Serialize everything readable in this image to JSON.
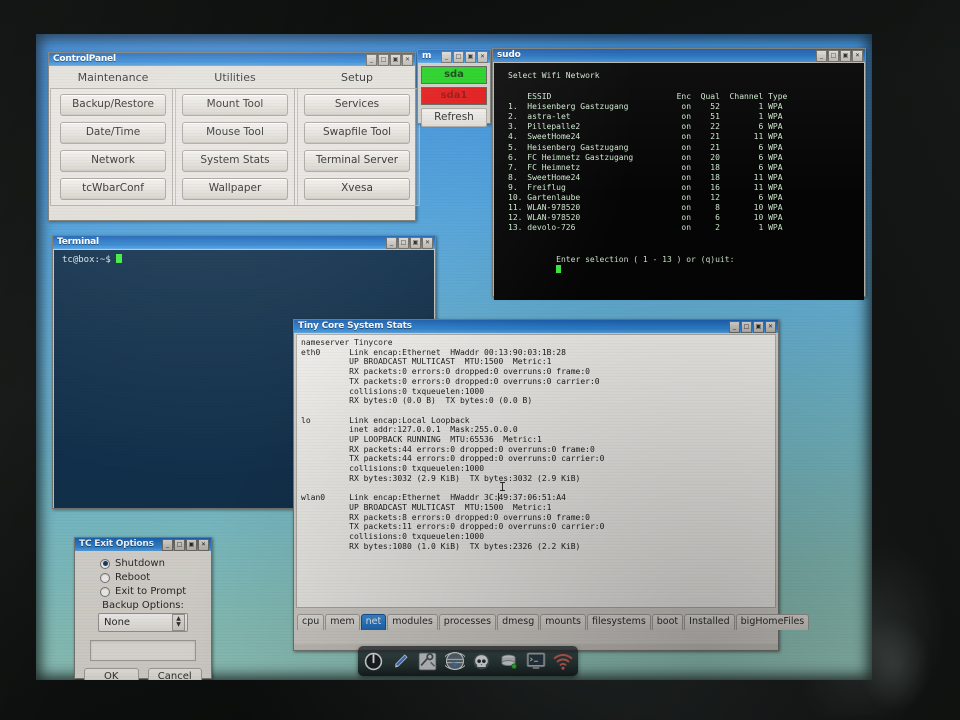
{
  "desktop": {
    "name": "Tiny Core Linux desktop photographed on a monitor"
  },
  "control_panel": {
    "title": "ControlPanel",
    "columns": [
      {
        "caption": "Maintenance",
        "buttons": [
          "Backup/Restore",
          "Date/Time",
          "Network",
          "tcWbarConf"
        ]
      },
      {
        "caption": "Utilities",
        "buttons": [
          "Mount Tool",
          "Mouse Tool",
          "System Stats",
          "Wallpaper"
        ]
      },
      {
        "caption": "Setup",
        "buttons": [
          "Services",
          "Swapfile Tool",
          "Terminal Server",
          "Xvesa"
        ]
      }
    ],
    "window_buttons": [
      "_",
      "□",
      "▣",
      "✕"
    ]
  },
  "mount_tool": {
    "title": "m",
    "devices": [
      {
        "label": "sda",
        "state": "mounted",
        "color": "#1fd01f"
      },
      {
        "label": "sda1",
        "state": "unmounted",
        "color": "#e21414"
      }
    ],
    "refresh_label": "Refresh",
    "window_buttons": [
      "_",
      "□",
      "▣",
      "✕"
    ]
  },
  "sudo_window": {
    "title": "sudo",
    "heading": "Select Wifi Network",
    "columns": [
      "ESSID",
      "Enc",
      "Qual",
      "Channel",
      "Type"
    ],
    "networks": [
      {
        "n": "1.",
        "essid": "Heisenberg Gastzugang",
        "enc": "on",
        "qual": "52",
        "channel": "1",
        "type": "WPA"
      },
      {
        "n": "2.",
        "essid": "astra-let",
        "enc": "on",
        "qual": "51",
        "channel": "1",
        "type": "WPA"
      },
      {
        "n": "3.",
        "essid": "Pillepalle2",
        "enc": "on",
        "qual": "22",
        "channel": "6",
        "type": "WPA"
      },
      {
        "n": "4.",
        "essid": "SweetHome24",
        "enc": "on",
        "qual": "21",
        "channel": "11",
        "type": "WPA"
      },
      {
        "n": "5.",
        "essid": "Heisenberg Gastzugang",
        "enc": "on",
        "qual": "21",
        "channel": "6",
        "type": "WPA"
      },
      {
        "n": "6.",
        "essid": "FC Heimnetz Gastzugang",
        "enc": "on",
        "qual": "20",
        "channel": "6",
        "type": "WPA"
      },
      {
        "n": "7.",
        "essid": "FC Heimnetz",
        "enc": "on",
        "qual": "18",
        "channel": "6",
        "type": "WPA"
      },
      {
        "n": "8.",
        "essid": "SweetHome24",
        "enc": "on",
        "qual": "18",
        "channel": "11",
        "type": "WPA"
      },
      {
        "n": "9.",
        "essid": "Freiflug",
        "enc": "on",
        "qual": "16",
        "channel": "11",
        "type": "WPA"
      },
      {
        "n": "10.",
        "essid": "Gartenlaube",
        "enc": "on",
        "qual": "12",
        "channel": "6",
        "type": "WPA"
      },
      {
        "n": "11.",
        "essid": "WLAN-978520",
        "enc": "on",
        "qual": "8",
        "channel": "10",
        "type": "WPA"
      },
      {
        "n": "12.",
        "essid": "WLAN-978520",
        "enc": "on",
        "qual": "6",
        "channel": "10",
        "type": "WPA"
      },
      {
        "n": "13.",
        "essid": "devolo-726",
        "enc": "on",
        "qual": "2",
        "channel": "1",
        "type": "WPA"
      }
    ],
    "prompt": "Enter selection ( 1 - 13 ) or (q)uit:",
    "window_buttons": [
      "_",
      "□",
      "▣",
      "✕"
    ]
  },
  "terminal": {
    "title": "Terminal",
    "prompt": "tc@box:~$",
    "window_buttons": [
      "_",
      "□",
      "▣",
      "✕"
    ]
  },
  "exit_options": {
    "title": "TC Exit Options",
    "radios": [
      {
        "label": "Shutdown",
        "selected": true
      },
      {
        "label": "Reboot",
        "selected": false
      },
      {
        "label": "Exit to Prompt",
        "selected": false
      }
    ],
    "backup_label": "Backup Options:",
    "backup_value": "None",
    "text_field_value": "",
    "ok_label": "OK",
    "cancel_label": "Cancel",
    "window_buttons": [
      "_",
      "□",
      "▣",
      "✕"
    ]
  },
  "system_stats": {
    "title": "Tiny Core System Stats",
    "output": "nameserver Tinycore\neth0      Link encap:Ethernet  HWaddr 00:13:90:03:1B:28\n          UP BROADCAST MULTICAST  MTU:1500  Metric:1\n          RX packets:0 errors:0 dropped:0 overruns:0 frame:0\n          TX packets:0 errors:0 dropped:0 overruns:0 carrier:0\n          collisions:0 txqueuelen:1000\n          RX bytes:0 (0.0 B)  TX bytes:0 (0.0 B)\n\nlo        Link encap:Local Loopback\n          inet addr:127.0.0.1  Mask:255.0.0.0\n          UP LOOPBACK RUNNING  MTU:65536  Metric:1\n          RX packets:44 errors:0 dropped:0 overruns:0 frame:0\n          TX packets:44 errors:0 dropped:0 overruns:0 carrier:0\n          collisions:0 txqueuelen:1000\n          RX bytes:3032 (2.9 KiB)  TX bytes:3032 (2.9 KiB)\n\nwlan0     Link encap:Ethernet  HWaddr 3C:49:37:06:51:A4\n          UP BROADCAST MULTICAST  MTU:1500  Metric:1\n          RX packets:8 errors:0 dropped:0 overruns:0 frame:0\n          TX packets:11 errors:0 dropped:0 overruns:0 carrier:0\n          collisions:0 txqueuelen:1000\n          RX bytes:1080 (1.0 KiB)  TX bytes:2326 (2.2 KiB)",
    "tabs": [
      {
        "label": "cpu",
        "selected": false
      },
      {
        "label": "mem",
        "selected": false
      },
      {
        "label": "net",
        "selected": true
      },
      {
        "label": "modules",
        "selected": false
      },
      {
        "label": "processes",
        "selected": false
      },
      {
        "label": "dmesg",
        "selected": false
      },
      {
        "label": "mounts",
        "selected": false
      },
      {
        "label": "filesystems",
        "selected": false
      },
      {
        "label": "boot",
        "selected": false
      },
      {
        "label": "Installed",
        "selected": false
      },
      {
        "label": "bigHomeFiles",
        "selected": false
      }
    ],
    "window_buttons": [
      "_",
      "□",
      "▣",
      "✕"
    ]
  },
  "wbar": {
    "icons": [
      "power-icon",
      "pen-icon",
      "control-panel-icon",
      "app-browser-icon",
      "skull-icon",
      "mount-tool-icon",
      "terminal-icon",
      "wifi-icon"
    ]
  },
  "colors": {
    "titlebar_blue": "#2a79c8",
    "tab_selected": "#2b7fd0",
    "mounted_green": "#1fd01f",
    "unmounted_red": "#e21414",
    "cursor_green": "#3ef03e",
    "terminal_bg": "#12324e",
    "sudo_bg": "#050505"
  }
}
